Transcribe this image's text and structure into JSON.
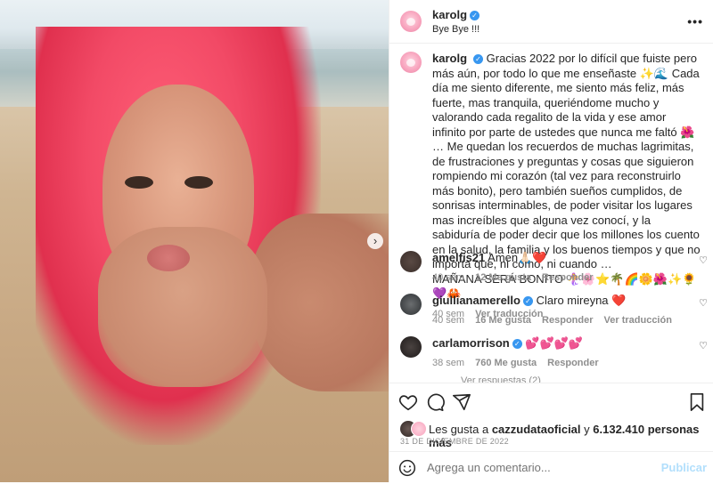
{
  "post": {
    "username": "karolg",
    "subtitle": "Bye Bye !!!",
    "caption": "Gracias 2022 por lo difícil que fuiste pero más aún, por todo lo que me enseñaste ✨🌊 Cada día me siento diferente, me siento más feliz, más fuerte, mas tranquila, queriéndome mucho y valorando cada regalito de la vida y ese amor infinito por parte de ustedes que nunca me faltó 🌺 … Me quedan los recuerdos de muchas lagrimitas, de frustraciones y preguntas y cosas que siguieron rompiendo mi corazón (tal vez para reconstruirlo más bonito), pero también sueños cumplidos, de sonrisas interminables, de poder visitar los lugares mas increíbles que alguna vez conocí, y la sabiduría de poder decir que los millones los cuento en la salud, la familia y los buenos tiempos y que no importa que, ni cómo, ni cuando …",
    "caption_end": "MAÑANA SERÁ BONITO 🧜‍♀️🌸⭐🌴🌈🌼🌺✨🌻💜🦀",
    "caption_time": "40 sem",
    "see_translation": "Ver traducción"
  },
  "comments": [
    {
      "user": "amelfis21",
      "verified": false,
      "text": "Amen🙏🏻❤️",
      "time": "40 sem",
      "likes": "12 Me gusta",
      "reply": "Responder",
      "translate": ""
    },
    {
      "user": "giullianamerello",
      "verified": true,
      "text": "Claro mireyna ❤️",
      "time": "40 sem",
      "likes": "16 Me gusta",
      "reply": "Responder",
      "translate": "Ver traducción"
    },
    {
      "user": "carlamorrison",
      "verified": true,
      "text": "💕💕💕💕",
      "time": "38 sem",
      "likes": "760 Me gusta",
      "reply": "Responder",
      "translate": ""
    }
  ],
  "view_replies": "Ver respuestas (2)",
  "likes": {
    "prefix": "Les gusta a ",
    "user": "cazzudataoficial",
    "mid": " y ",
    "count": "6.132.410 personas más"
  },
  "date": "31 DE DICIEMBRE DE 2022",
  "add_comment": {
    "placeholder": "Agrega un comentario...",
    "publish": "Publicar"
  },
  "icons": {
    "more": "more-icon",
    "verified": "verified-badge-icon",
    "heart": "heart-icon",
    "comment": "comment-icon",
    "share": "share-icon",
    "save": "bookmark-icon",
    "emoji": "emoji-icon",
    "next": "chevron-right-icon"
  },
  "colors": {
    "verified": "#3897f0",
    "publish": "#b2dffc",
    "muted": "#8e8e8e"
  }
}
